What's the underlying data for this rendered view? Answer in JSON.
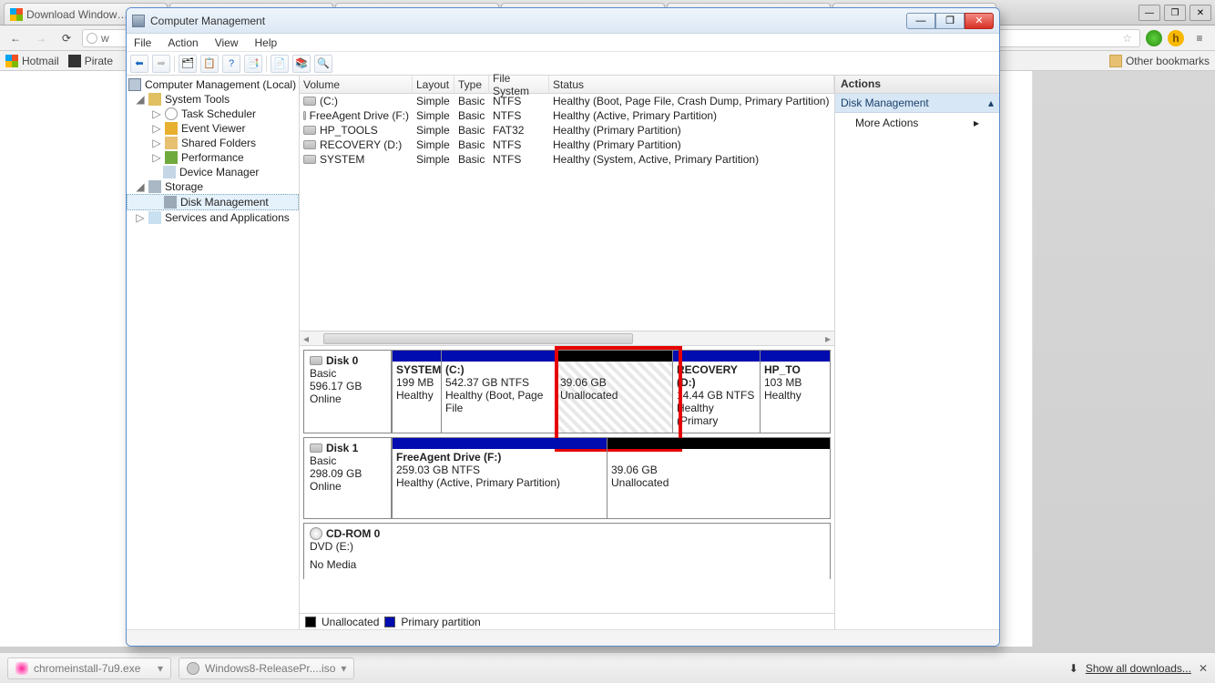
{
  "chrome": {
    "tabs": [
      "Download Window…",
      "",
      "",
      "",
      "",
      ""
    ],
    "win_min": "—",
    "win_max": "❐",
    "win_close": "✕",
    "back": "←",
    "fwd": "→",
    "reload": "⟳",
    "url_prefix": "w",
    "bookmarks": {
      "hotmail": "Hotmail",
      "pirate": "Pirate",
      "other": "Other bookmarks"
    }
  },
  "app": {
    "title": "Computer Management",
    "menu": [
      "File",
      "Action",
      "View",
      "Help"
    ],
    "tree": {
      "root": "Computer Management (Local)",
      "systools": "System Tools",
      "task": "Task Scheduler",
      "event": "Event Viewer",
      "shared": "Shared Folders",
      "perf": "Performance",
      "devmgr": "Device Manager",
      "storage": "Storage",
      "diskmgmt": "Disk Management",
      "services": "Services and Applications"
    },
    "cols": {
      "volume": "Volume",
      "layout": "Layout",
      "type": "Type",
      "fs": "File System",
      "status": "Status"
    },
    "vols": [
      {
        "name": "(C:)",
        "layout": "Simple",
        "type": "Basic",
        "fs": "NTFS",
        "status": "Healthy (Boot, Page File, Crash Dump, Primary Partition)"
      },
      {
        "name": "FreeAgent Drive (F:)",
        "layout": "Simple",
        "type": "Basic",
        "fs": "NTFS",
        "status": "Healthy (Active, Primary Partition)"
      },
      {
        "name": "HP_TOOLS",
        "layout": "Simple",
        "type": "Basic",
        "fs": "FAT32",
        "status": "Healthy (Primary Partition)"
      },
      {
        "name": "RECOVERY (D:)",
        "layout": "Simple",
        "type": "Basic",
        "fs": "NTFS",
        "status": "Healthy (Primary Partition)"
      },
      {
        "name": "SYSTEM",
        "layout": "Simple",
        "type": "Basic",
        "fs": "NTFS",
        "status": "Healthy (System, Active, Primary Partition)"
      }
    ],
    "disk0": {
      "label": "Disk 0",
      "basic": "Basic",
      "size": "596.17 GB",
      "online": "Online",
      "p_system_name": "SYSTEM",
      "p_system_size": "199 MB",
      "p_system_health": "Healthy",
      "p_c_name": "(C:)",
      "p_c_size": "542.37 GB NTFS",
      "p_c_health": "Healthy (Boot, Page File",
      "p_un_size": "39.06 GB",
      "p_un_health": "Unallocated",
      "p_rec_name": "RECOVERY  (D:)",
      "p_rec_size": "14.44 GB NTFS",
      "p_rec_health": "Healthy (Primary",
      "p_hp_name": "HP_TO",
      "p_hp_size": "103 MB",
      "p_hp_health": "Healthy"
    },
    "disk1": {
      "label": "Disk 1",
      "basic": "Basic",
      "size": "298.09 GB",
      "online": "Online",
      "p_f_name": "FreeAgent Drive  (F:)",
      "p_f_size": "259.03 GB NTFS",
      "p_f_health": "Healthy (Active, Primary Partition)",
      "p_un_size": "39.06 GB",
      "p_un_health": "Unallocated"
    },
    "cd": {
      "label": "CD-ROM 0",
      "dvd": "DVD (E:)",
      "nomedia": "No Media"
    },
    "legend": {
      "unalloc": "Unallocated",
      "primary": "Primary partition"
    },
    "actions": {
      "head": "Actions",
      "dm": "Disk Management",
      "more": "More Actions"
    }
  },
  "downloads": {
    "item1": "chromeinstall-7u9.exe",
    "item2": "Windows8-ReleasePr....iso",
    "show": "Show all downloads..."
  }
}
